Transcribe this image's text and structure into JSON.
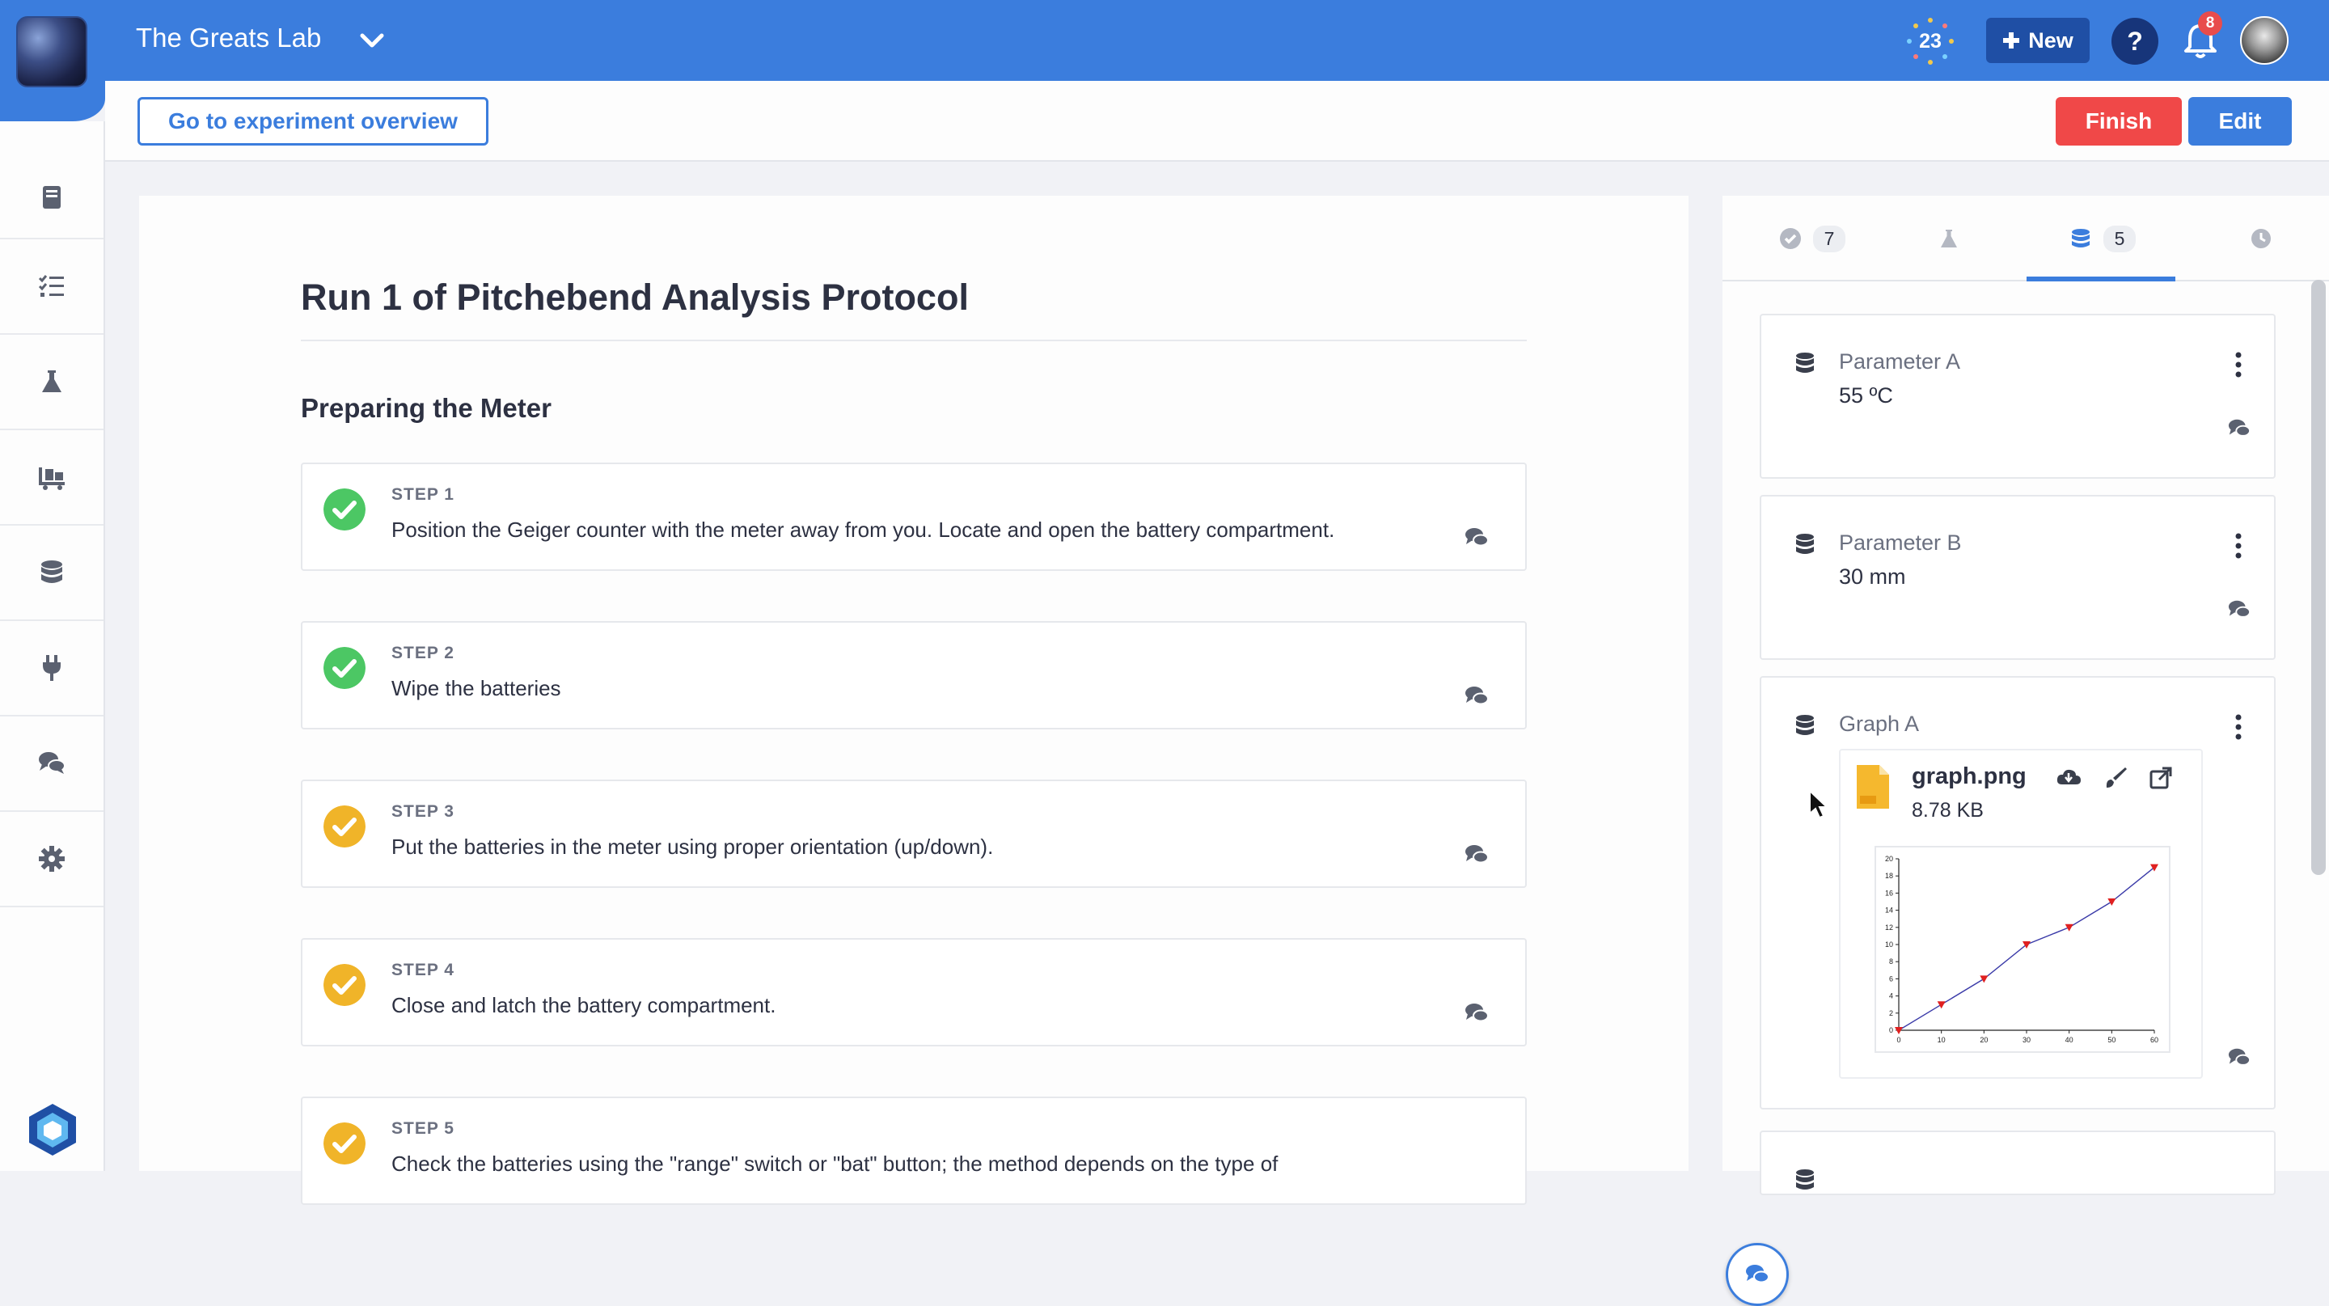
{
  "header": {
    "lab_name": "The Greats Lab",
    "counter": "23",
    "new_label": "New",
    "help_label": "?",
    "notifications_count": "8",
    "accent_color": "#3b7ddd"
  },
  "toolbar": {
    "overview_label": "Go to experiment overview",
    "finish_label": "Finish",
    "edit_label": "Edit"
  },
  "sidebar": {
    "items": [
      "book-icon",
      "checklist-icon",
      "flask-icon",
      "equipment-icon",
      "database-icon",
      "plug-icon",
      "chat-icon",
      "gear-icon"
    ]
  },
  "protocol": {
    "title": "Run 1 of Pitchebend Analysis Protocol",
    "section": "Preparing the Meter",
    "steps": [
      {
        "label": "STEP 1",
        "text": "Position the Geiger counter with the meter away from you. Locate and open the battery compartment.",
        "status": "done",
        "color": "#4cc764"
      },
      {
        "label": "STEP 2",
        "text": "Wipe the batteries",
        "status": "done",
        "color": "#4cc764"
      },
      {
        "label": "STEP 3",
        "text": "Put the batteries in the meter using proper orientation (up/down).",
        "status": "partial",
        "color": "#f0b429"
      },
      {
        "label": "STEP 4",
        "text": "Close and latch the battery compartment.",
        "status": "partial",
        "color": "#f0b429"
      },
      {
        "label": "STEP 5",
        "text": "Check the batteries using the \"range\" switch or \"bat\" button; the method depends on the type of",
        "status": "partial",
        "color": "#f0b429"
      }
    ]
  },
  "right_panel": {
    "tabs": [
      {
        "icon": "check-circle-icon",
        "count": "7"
      },
      {
        "icon": "flask-icon",
        "count": ""
      },
      {
        "icon": "database-icon",
        "count": "5",
        "active": true
      },
      {
        "icon": "clock-icon",
        "count": ""
      }
    ],
    "params": [
      {
        "name": "Parameter A",
        "value": "55 ºC"
      },
      {
        "name": "Parameter B",
        "value": "30 mm"
      },
      {
        "name": "Graph A",
        "file_name": "graph.png",
        "file_size": "8.78 KB"
      }
    ]
  },
  "graph": {
    "x_ticks": [
      "0",
      "10",
      "20",
      "30",
      "40",
      "50",
      "60"
    ],
    "y_ticks": [
      "0",
      "2",
      "4",
      "6",
      "8",
      "10",
      "12",
      "14",
      "16",
      "18",
      "20"
    ],
    "points": [
      [
        0,
        0
      ],
      [
        10,
        3
      ],
      [
        20,
        6
      ],
      [
        30,
        10
      ],
      [
        40,
        12
      ],
      [
        50,
        15
      ],
      [
        60,
        19
      ]
    ]
  }
}
